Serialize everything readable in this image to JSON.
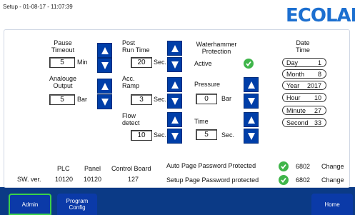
{
  "header": {
    "title": "Setup - 01-08-17 - 11:07:39",
    "logo": "ECOLAB"
  },
  "pause_timeout": {
    "label_line1": "Pause",
    "label_line2": "Timeout",
    "value": "5",
    "unit": "Min"
  },
  "analogue_output": {
    "label_line1": "Analouge",
    "label_line2": "Output",
    "value": "5",
    "unit": "Bar"
  },
  "post_run_time": {
    "label_line1": "Post",
    "label_line2": "Run Time",
    "value": "20",
    "unit": "Sec."
  },
  "acc_ramp": {
    "label_line1": "Acc.",
    "label_line2": "Ramp",
    "value": "3",
    "unit": "Sec."
  },
  "flow_detect": {
    "label_line1": "Flow",
    "label_line2": "detect",
    "value": "10",
    "unit": "Sec."
  },
  "waterhammer": {
    "label_line1": "Waterhammer",
    "label_line2": "Protection",
    "active_label": "Active"
  },
  "pressure": {
    "label": "Pressure",
    "value": "0",
    "unit": "Bar"
  },
  "time": {
    "label": "Time",
    "value": "5",
    "unit": "Sec."
  },
  "date_time": {
    "label_line1": "Date",
    "label_line2": "Time",
    "fields": [
      {
        "key": "Day",
        "value": "1"
      },
      {
        "key": "Month",
        "value": "8"
      },
      {
        "key": "Year",
        "value": "2017"
      },
      {
        "key": "Hour",
        "value": "10"
      },
      {
        "key": "Minute",
        "value": "27"
      },
      {
        "key": "Second",
        "value": "33"
      }
    ]
  },
  "versions": {
    "row_label": "SW. ver.",
    "headers": [
      "PLC",
      "Panel",
      "Control Board"
    ],
    "values": [
      "10120",
      "10120",
      "127"
    ]
  },
  "passwords": [
    {
      "label": "Auto Page Password Protected",
      "code": "6802",
      "action": "Change"
    },
    {
      "label": "Setup Page Password protected",
      "code": "6802",
      "action": "Change"
    }
  ],
  "nav": {
    "admin": "Admin",
    "program_line1": "Program",
    "program_line2": "Config",
    "home": "Home"
  },
  "colors": {
    "accent": "#003ea8",
    "background": "#0b3a86",
    "ok": "#3fb54a",
    "active_border": "#3bd14a"
  }
}
